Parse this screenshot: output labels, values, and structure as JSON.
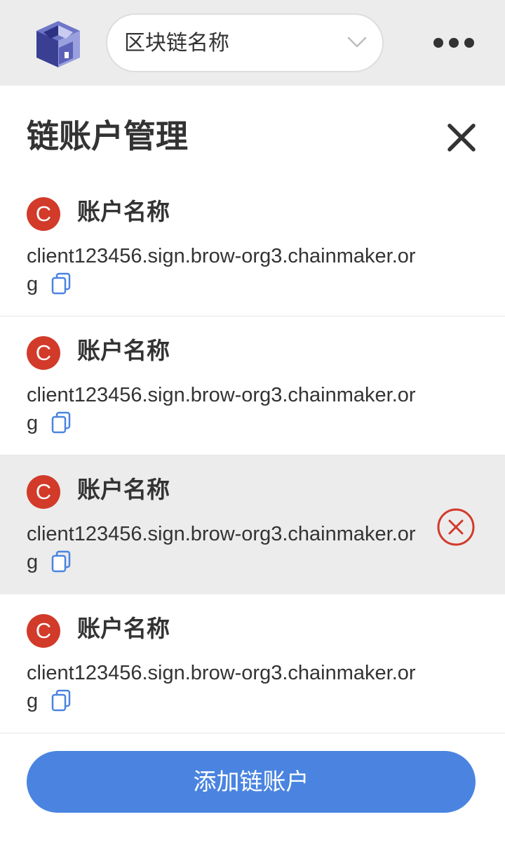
{
  "header": {
    "logo_icon": "cube-logo-icon",
    "chain_select": {
      "label": "区块链名称",
      "icon": "chevron-down-icon"
    },
    "more_icon": "more-dots-icon"
  },
  "page": {
    "title": "链账户管理",
    "close_icon": "close-icon"
  },
  "accounts": [
    {
      "badge": "C",
      "name": "账户名称",
      "address": "client123456.sign.brow-org3.chainmaker.org",
      "selected": false
    },
    {
      "badge": "C",
      "name": "账户名称",
      "address": "client123456.sign.brow-org3.chainmaker.org",
      "selected": false
    },
    {
      "badge": "C",
      "name": "账户名称",
      "address": "client123456.sign.brow-org3.chainmaker.org",
      "selected": true
    },
    {
      "badge": "C",
      "name": "账户名称",
      "address": "client123456.sign.brow-org3.chainmaker.org",
      "selected": false
    }
  ],
  "footer": {
    "add_button_label": "添加链账户"
  },
  "colors": {
    "primary": "#4a84e0",
    "badge": "#d23a2a",
    "remove": "#d23a2a",
    "copy_icon": "#4a84e0",
    "selected_row": "#ececec"
  }
}
